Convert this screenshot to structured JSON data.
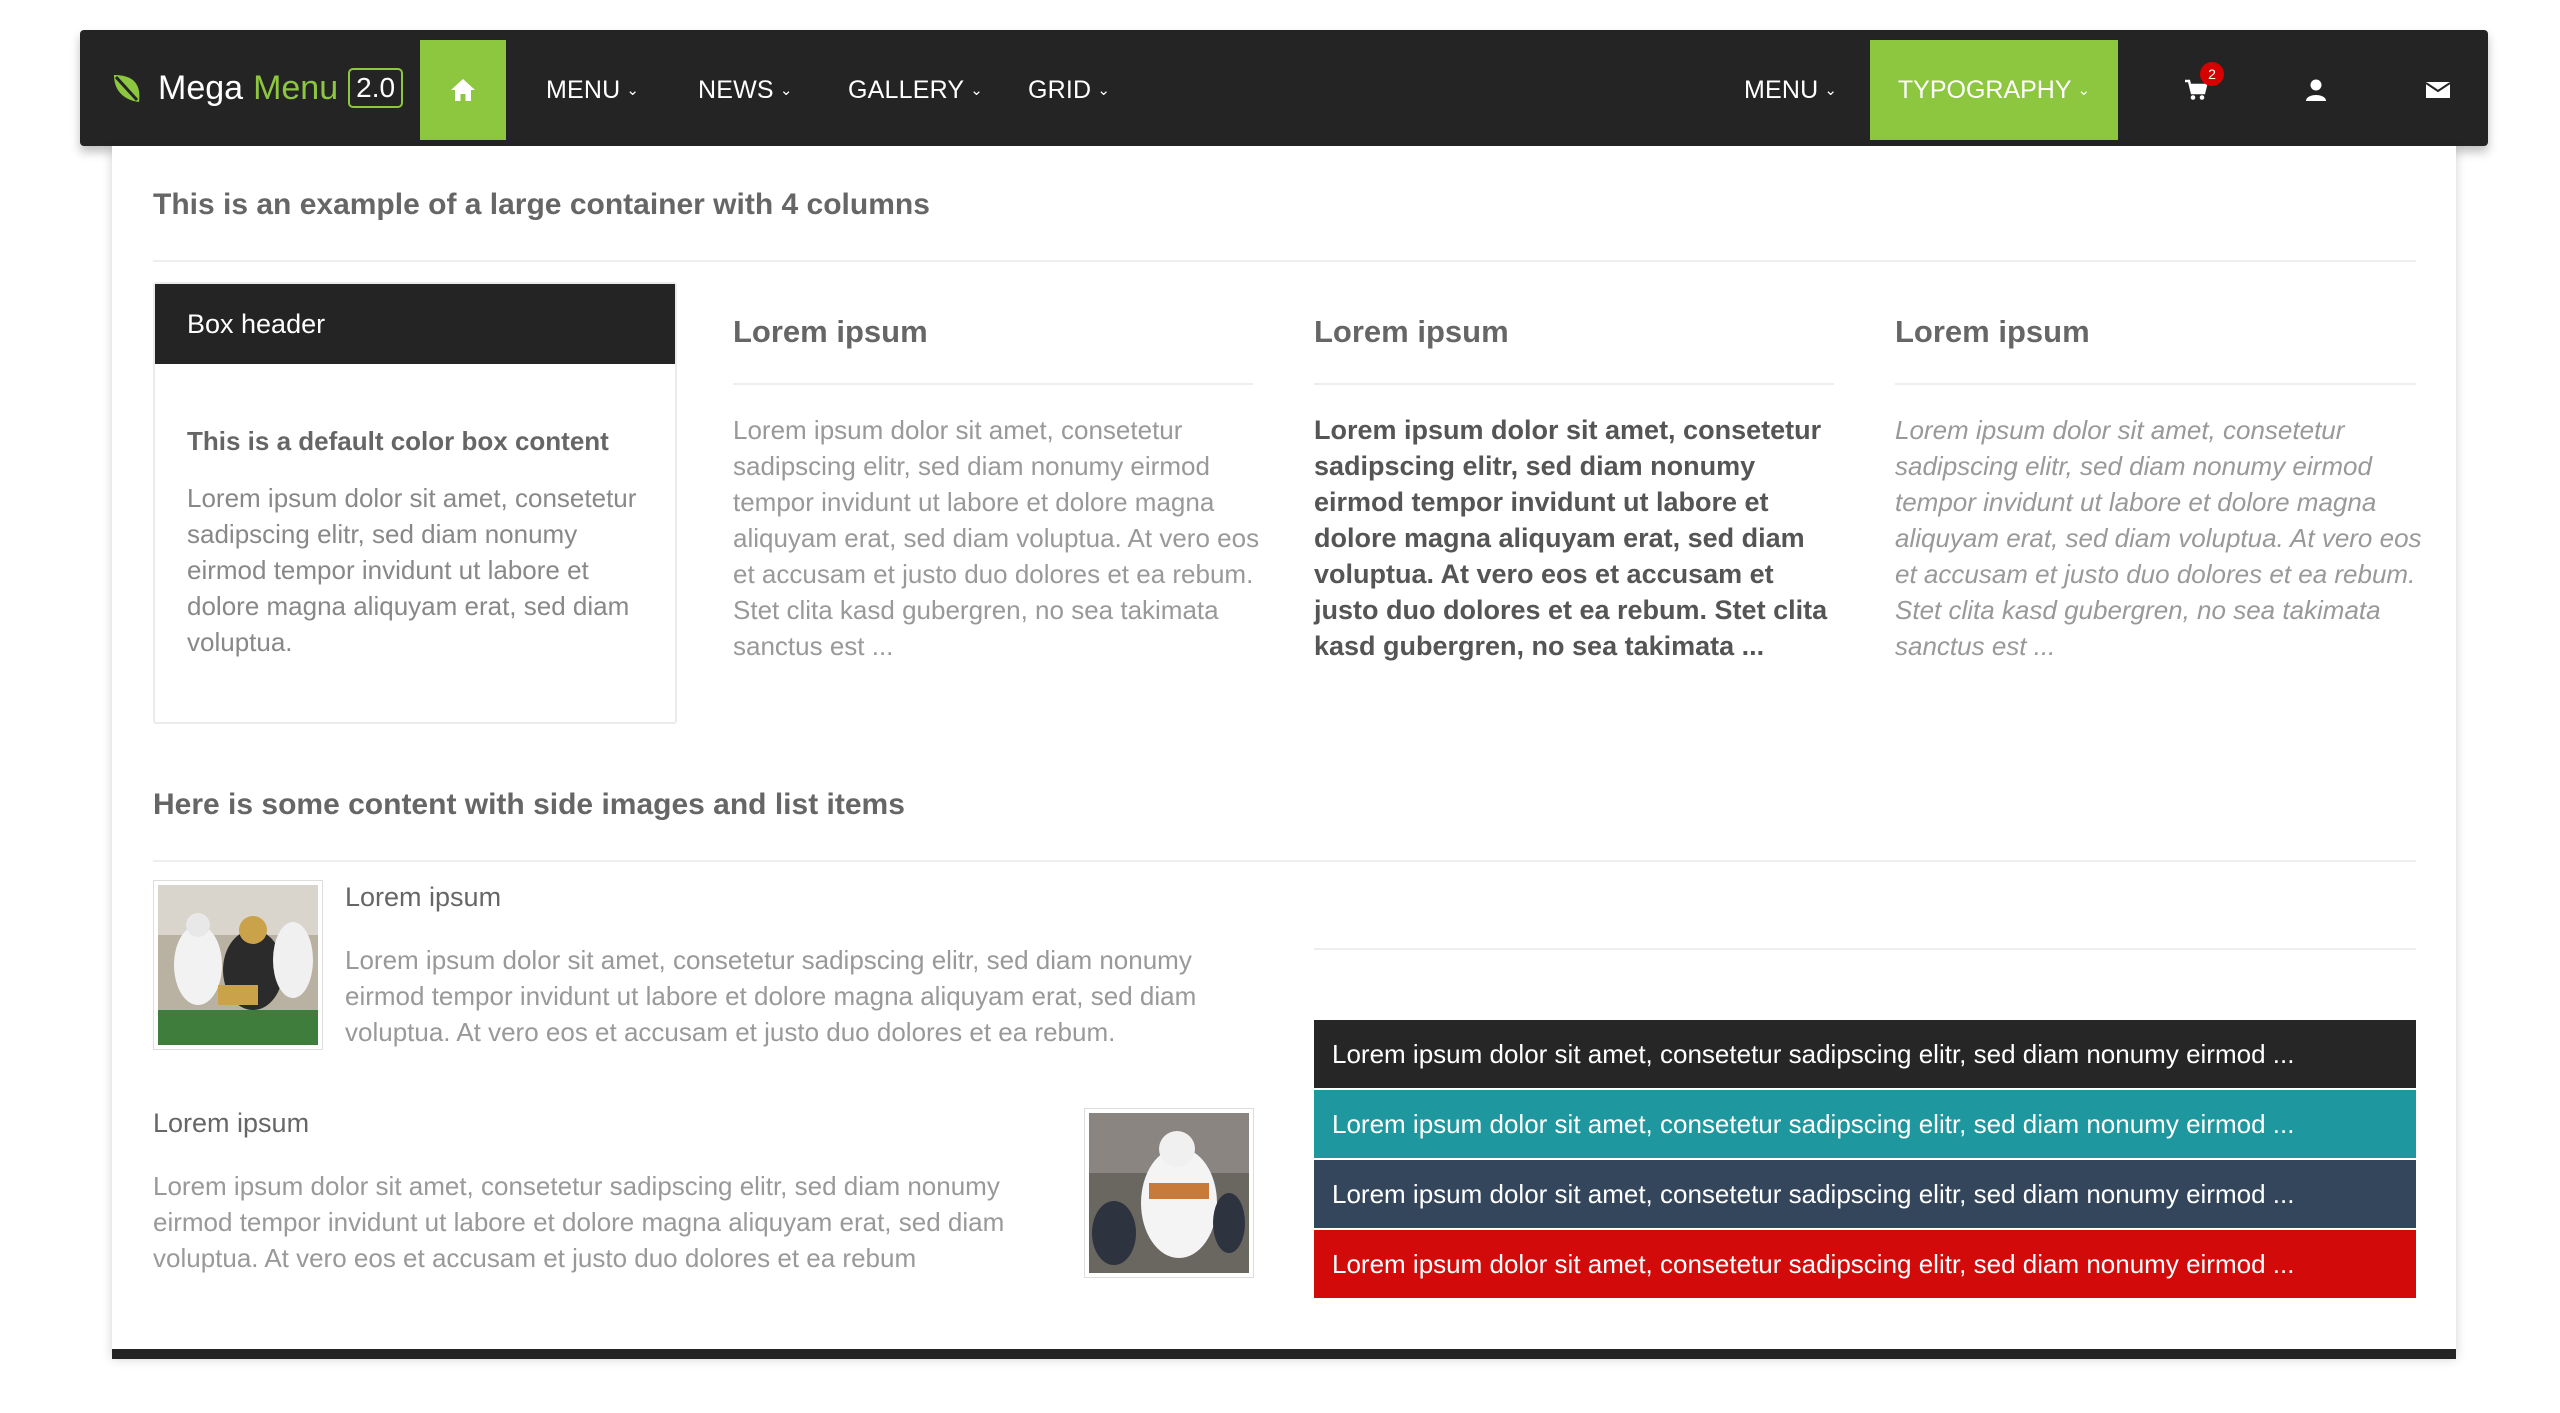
{
  "navbar": {
    "brand_mega": "Mega",
    "brand_menu": "Menu",
    "brand_version": "2.0",
    "left_items": [
      "MENU",
      "NEWS",
      "GALLERY",
      "GRID"
    ],
    "right_menu": "MENU",
    "typography": "TYPOGRAPHY",
    "cart_count": "2",
    "icons": [
      "home-icon",
      "cart-icon",
      "user-icon",
      "envelope-icon"
    ],
    "accent_color": "#8dc63f"
  },
  "section1": {
    "title": "This is an example of a large container with 4 columns",
    "box_header": "Box header",
    "box_subtitle": "This is a default color box content",
    "box_text": "Lorem ipsum dolor sit amet, consetetur sadipscing elitr, sed diam nonumy eirmod tempor invidunt ut labore et dolore magna aliquyam erat, sed diam voluptua.",
    "columns": [
      {
        "title": "Lorem ipsum",
        "text": "Lorem ipsum dolor sit amet, consetetur sadipscing elitr, sed diam nonumy eirmod tempor invidunt ut labore et dolore magna aliquyam erat, sed diam voluptua. At vero eos et accusam et justo duo dolores et ea rebum. Stet clita kasd gubergren, no sea takimata sanctus est ..."
      },
      {
        "title": "Lorem ipsum",
        "text": "Lorem ipsum dolor sit amet, consetetur sadipscing elitr, sed diam nonumy eirmod tempor invidunt ut labore et dolore magna aliquyam erat, sed diam voluptua. At vero eos et accusam et justo duo dolores et ea rebum. Stet clita kasd gubergren, no sea takimata ..."
      },
      {
        "title": "Lorem ipsum",
        "text": "Lorem ipsum dolor sit amet, consetetur sadipscing elitr, sed diam nonumy eirmod tempor invidunt ut labore et dolore magna aliquyam erat, sed diam voluptua. At vero eos et accusam et justo duo dolores et ea rebum. Stet clita kasd gubergren, no sea takimata sanctus est ..."
      }
    ]
  },
  "section2": {
    "title": "Here is some content with side images and list items",
    "media": [
      {
        "title": "Lorem ipsum",
        "text": "Lorem ipsum dolor sit amet, consetetur sadipscing elitr, sed diam nonumy eirmod tempor invidunt ut labore et dolore magna aliquyam erat, sed diam voluptua. At vero eos et accusam et justo duo dolores et ea rebum."
      },
      {
        "title": "Lorem ipsum",
        "text": "Lorem ipsum dolor sit amet, consetetur sadipscing elitr, sed diam nonumy eirmod tempor invidunt ut labore et dolore magna aliquyam erat, sed diam voluptua. At vero eos et accusam et justo duo dolores et ea rebum"
      }
    ],
    "list_items": [
      {
        "text": "Lorem ipsum dolor sit amet, consetetur sadipscing elitr, sed diam nonumy eirmod ...",
        "color": "#262626"
      },
      {
        "text": "Lorem ipsum dolor sit amet, consetetur sadipscing elitr, sed diam nonumy eirmod ...",
        "color": "#1e979e"
      },
      {
        "text": "Lorem ipsum dolor sit amet, consetetur sadipscing elitr, sed diam nonumy eirmod ...",
        "color": "#34465c"
      },
      {
        "text": "Lorem ipsum dolor sit amet, consetetur sadipscing elitr, sed diam nonumy eirmod ...",
        "color": "#d30a0a"
      }
    ]
  }
}
